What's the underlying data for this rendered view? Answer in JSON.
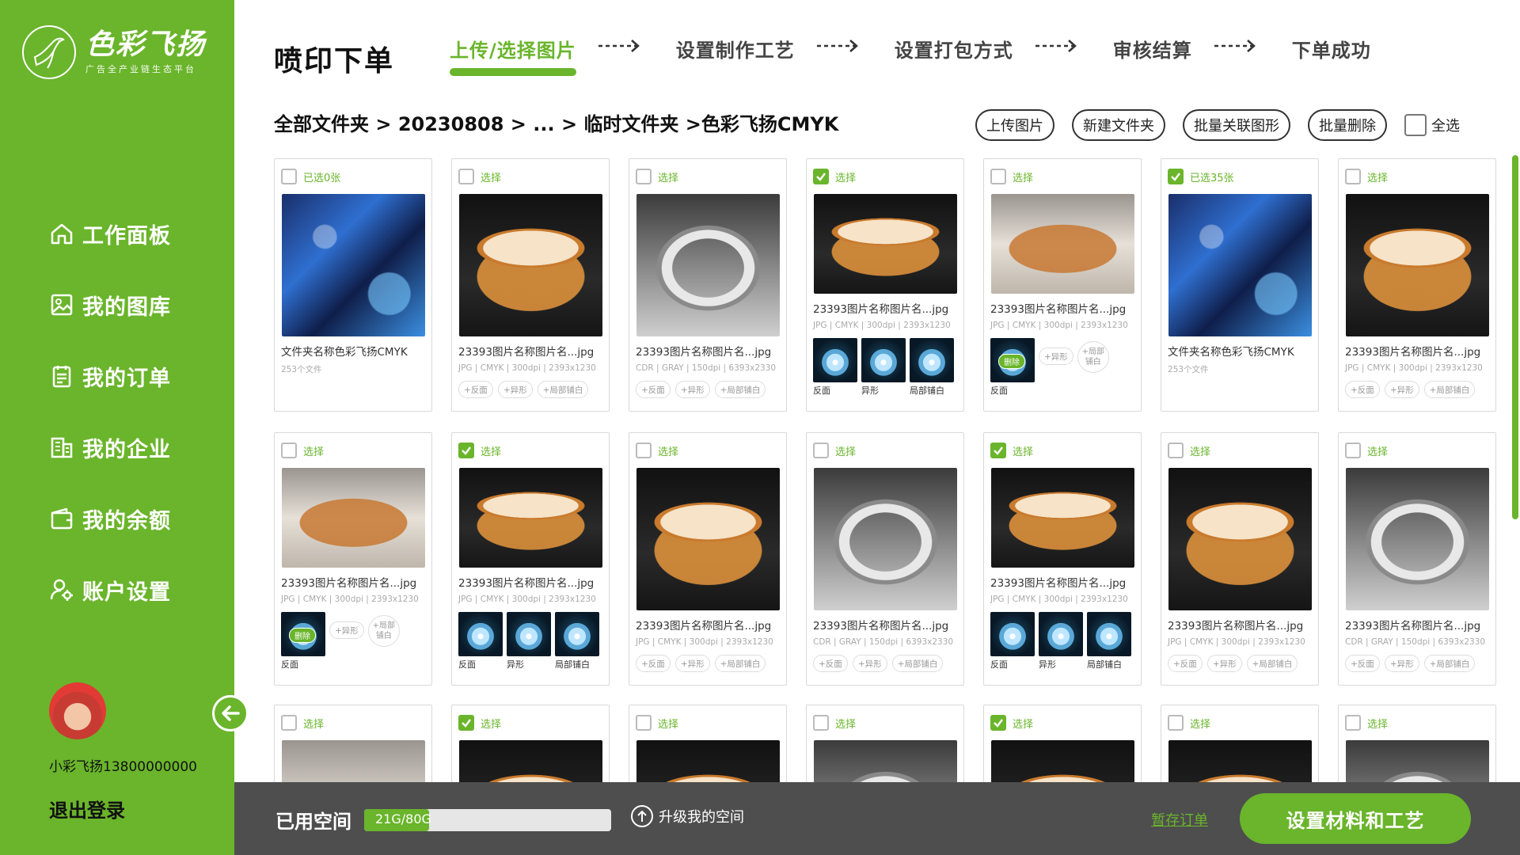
{
  "brand": {
    "name": "色彩飞扬",
    "tagline": "广告全产业链生态平台",
    "accent": "#6ab52b"
  },
  "sidebar": {
    "items": [
      {
        "label": "工作面板",
        "icon": "home-icon"
      },
      {
        "label": "我的图库",
        "icon": "image-icon"
      },
      {
        "label": "我的订单",
        "icon": "order-icon"
      },
      {
        "label": "我的企业",
        "icon": "building-icon"
      },
      {
        "label": "我的余额",
        "icon": "wallet-icon"
      },
      {
        "label": "账户设置",
        "icon": "user-settings-icon"
      }
    ],
    "username": "小彩飞扬13800000000",
    "logout": "退出登录"
  },
  "header": {
    "title": "喷印下单",
    "steps": [
      "上传/选择图片",
      "设置制作工艺",
      "设置打包方式",
      "审核结算",
      "下单成功"
    ],
    "active_step": 0
  },
  "breadcrumb": [
    "全部文件夹",
    "20230808",
    "...",
    "临时文件夹",
    "色彩飞扬CMYK"
  ],
  "actions": {
    "upload": "上传图片",
    "new_folder": "新建文件夹",
    "batch_link": "批量关联图形",
    "batch_delete": "批量删除",
    "select_all": "全选"
  },
  "cards": [
    {
      "head": "已选0张",
      "checked": false,
      "thumb": "anime",
      "title": "文件夹名称色彩飞扬CMYK",
      "sub": "253个文件",
      "mode": "folder"
    },
    {
      "head": "选择",
      "checked": false,
      "thumb": "drum-dark",
      "title": "23393图片名称图片名...jpg",
      "meta": "JPG | CMYK | 300dpi | 2393x1230",
      "mode": "tags"
    },
    {
      "head": "选择",
      "checked": false,
      "thumb": "ring",
      "title": "23393图片名称图片名...jpg",
      "meta": "CDR | GRAY | 150dpi | 6393x2330",
      "mode": "tags"
    },
    {
      "head": "选择",
      "checked": true,
      "thumb": "drum-dark",
      "title": "23393图片名称图片名...jpg",
      "meta": "JPG | CMYK | 300dpi | 2393x1230",
      "mode": "variants3"
    },
    {
      "head": "选择",
      "checked": false,
      "thumb": "drum-light",
      "title": "23393图片名称图片名...jpg",
      "meta": "JPG | CMYK | 300dpi | 2393x1230",
      "mode": "variant1"
    },
    {
      "head": "已选35张",
      "checked": true,
      "thumb": "anime",
      "title": "文件夹名称色彩飞扬CMYK",
      "sub": "253个文件",
      "mode": "folder"
    },
    {
      "head": "选择",
      "checked": false,
      "thumb": "drum-dark",
      "title": "23393图片名称图片名...jpg",
      "meta": "JPG | CMYK | 300dpi | 2393x1230",
      "mode": "tags"
    },
    {
      "head": "选择",
      "checked": false,
      "thumb": "drum-light",
      "title": "23393图片名称图片名...jpg",
      "meta": "JPG | CMYK | 300dpi | 2393x1230",
      "mode": "variant1"
    },
    {
      "head": "选择",
      "checked": true,
      "thumb": "drum-dark",
      "title": "23393图片名称图片名...jpg",
      "meta": "JPG | CMYK | 300dpi | 2393x1230",
      "mode": "variants3"
    },
    {
      "head": "选择",
      "checked": false,
      "thumb": "drum-dark",
      "title": "23393图片名称图片名...jpg",
      "meta": "JPG | CMYK | 300dpi | 2393x1230",
      "mode": "tags"
    },
    {
      "head": "选择",
      "checked": false,
      "thumb": "ring",
      "title": "23393图片名称图片名...jpg",
      "meta": "CDR | GRAY | 150dpi | 6393x2330",
      "mode": "tags"
    },
    {
      "head": "选择",
      "checked": true,
      "thumb": "drum-dark",
      "title": "23393图片名称图片名...jpg",
      "meta": "JPG | CMYK | 300dpi | 2393x1230",
      "mode": "variants3"
    },
    {
      "head": "选择",
      "checked": false,
      "thumb": "drum-dark",
      "title": "23393图片名称图片名...jpg",
      "meta": "JPG | CMYK | 300dpi | 2393x1230",
      "mode": "tags"
    },
    {
      "head": "选择",
      "checked": false,
      "thumb": "ring",
      "title": "23393图片名称图片名...jpg",
      "meta": "CDR | GRAY | 150dpi | 6393x2330",
      "mode": "tags"
    },
    {
      "head": "选择",
      "checked": false,
      "thumb": "drum-light",
      "mode": "cut"
    },
    {
      "head": "选择",
      "checked": true,
      "thumb": "drum-dark",
      "mode": "cut"
    },
    {
      "head": "选择",
      "checked": false,
      "thumb": "drum-dark",
      "mode": "cut"
    },
    {
      "head": "选择",
      "checked": false,
      "thumb": "ring",
      "mode": "cut"
    },
    {
      "head": "选择",
      "checked": true,
      "thumb": "drum-dark",
      "mode": "cut"
    },
    {
      "head": "选择",
      "checked": false,
      "thumb": "drum-dark",
      "mode": "cut"
    },
    {
      "head": "选择",
      "checked": false,
      "thumb": "ring",
      "mode": "cut"
    }
  ],
  "card_labels": {
    "tag_reverse": "+反面",
    "tag_shape": "+异形",
    "tag_white": "+局部铺白",
    "variant_reverse": "反面",
    "variant_shape": "异形",
    "variant_white": "局部铺白",
    "round_shape": "+异形",
    "round_white": "+局部铺白",
    "delete_badge": "删除"
  },
  "footer": {
    "used_label": "已用空间",
    "storage": "21G/80G",
    "storage_fraction": 0.2625,
    "upgrade": "升级我的空间",
    "draft": "暂存订单",
    "cta": "设置材料和工艺"
  }
}
